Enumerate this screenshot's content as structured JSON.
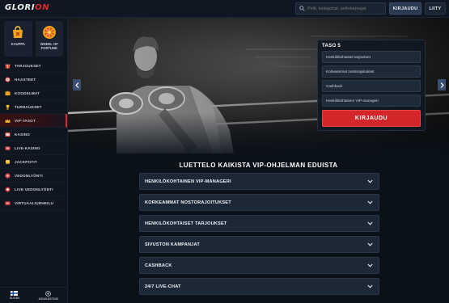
{
  "header": {
    "logo_main": "GLORI",
    "logo_accent": "ON",
    "search_placeholder": "Pelit, kategoriat, pelintarjoajat",
    "login_label": "KIRJAUDU",
    "join_label": "LIITY"
  },
  "sidebar": {
    "tiles": [
      {
        "label": "KAUPPA",
        "icon": "shop-icon"
      },
      {
        "label": "WHEEL OF FORTUNE",
        "icon": "wheel-icon"
      }
    ],
    "items": [
      {
        "label": "TARJOUKSET",
        "icon": "gift-icon"
      },
      {
        "label": "HAASTEET",
        "icon": "target-icon"
      },
      {
        "label": "KOODELMAT",
        "icon": "puzzle-icon"
      },
      {
        "label": "TURNAUKSET",
        "icon": "trophy-icon"
      },
      {
        "label": "VIP-TASOT",
        "icon": "crown-icon",
        "active": true
      },
      {
        "label": "KASINO",
        "icon": "slot-icon"
      },
      {
        "label": "LIVE-KASINO",
        "icon": "live-icon"
      },
      {
        "label": "JACKPOTIT",
        "icon": "coins-icon"
      },
      {
        "label": "VEDONLYÖNTI",
        "icon": "ball-icon"
      },
      {
        "label": "LIVE-VEDONLYÖNTI",
        "icon": "live-ball-icon"
      },
      {
        "label": "VIRTUAALIURHEILU",
        "icon": "virtual-icon"
      }
    ],
    "bottom": [
      {
        "label": "SUOMI",
        "icon": "flag-fi-icon"
      },
      {
        "label": "ASIAKASTUKI",
        "icon": "support-icon"
      }
    ]
  },
  "hero": {
    "card_title": "TASO 5",
    "benefits": [
      "Henkilökohtaiset tarjoukset",
      "Korkeammat nostorajoitukset",
      "Cashback",
      "Henkilökohtainen VIP-manageri"
    ],
    "join_label": "KIRJAUDU"
  },
  "main": {
    "title": "LUETTELO KAIKISTA VIP-OHJELMAN EDUISTA",
    "accordion": [
      "HENKILÖKOHTAINEN VIP-MANAGERI",
      "KORKEAMMAT NOSTORAJOITUKSET",
      "HENKILÖKOHTAISET TARJOUKSET",
      "SIVUSTON KAMPANJAT",
      "CASHBACK",
      "24/7 LIVE-CHAT"
    ]
  },
  "colors": {
    "accent": "#d3262b",
    "background": "#0b1119",
    "panel": "#1d2836"
  }
}
